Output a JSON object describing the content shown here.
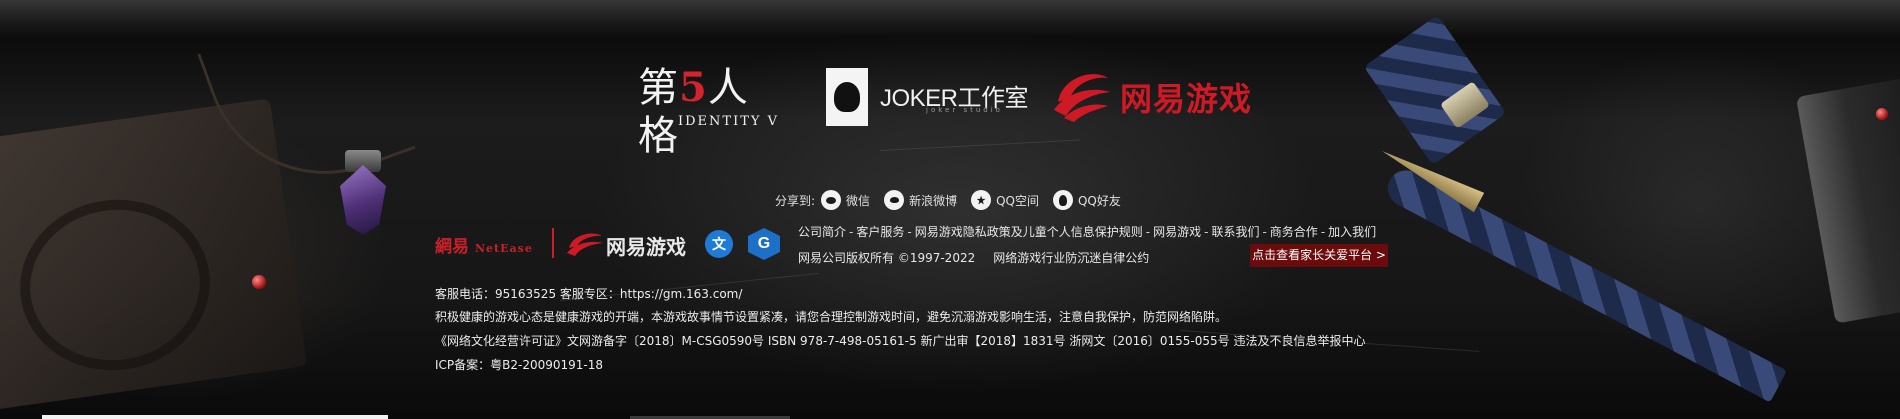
{
  "logos": {
    "identity_v": {
      "title_pre": "第",
      "title_num": "5",
      "title_post": "人格",
      "subtitle": "IDENTITY V"
    },
    "joker": {
      "name": "JOKER工作室",
      "sub": "joker studio"
    },
    "netease_games": {
      "name": "网易游戏"
    }
  },
  "share": {
    "label": "分享到:",
    "items": [
      {
        "label": "微信",
        "icon": "wechat-icon"
      },
      {
        "label": "新浪微博",
        "icon": "weibo-icon"
      },
      {
        "label": "QQ空间",
        "icon": "qzone-icon"
      },
      {
        "label": "QQ好友",
        "icon": "qq-icon"
      }
    ]
  },
  "brand_row": {
    "netease": "網易",
    "netease_en": "NetEase",
    "games": "网易游戏",
    "blue_badge": "文",
    "g_badge": "G"
  },
  "footer_links": [
    "公司简介",
    "客户服务",
    "网易游戏隐私政策及儿童个人信息保护规则",
    "网易游戏",
    "联系我们",
    "商务合作",
    "加入我们"
  ],
  "footer_sep": "-",
  "copyright": "网易公司版权所有 ©1997-2022",
  "self_discipline": "网络游戏行业防沉迷自律公约",
  "parent_button": "点击查看家长关爱平台 >",
  "info": {
    "service": "客服电话：95163525 客服专区：https://gm.163.com/",
    "notice": "积极健康的游戏心态是健康游戏的开端，本游戏故事情节设置紧凑，请您合理控制游戏时间，避免沉溺游戏影响生活，注意自我保护，防范网络陷阱。",
    "license": "《网络文化经营许可证》文网游备字〔2018〕M-CSG0590号 ISBN 978-7-498-05161-5 新广出审【2018】1831号 浙网文〔2016〕0155-055号 违法及不良信息举报中心",
    "icp": "ICP备案：粤B2-20090191-18"
  },
  "colors": {
    "brand_red": "#c8202a",
    "parent_button_bg": "#6b0b0b",
    "badge_blue": "#1f7ad6"
  }
}
